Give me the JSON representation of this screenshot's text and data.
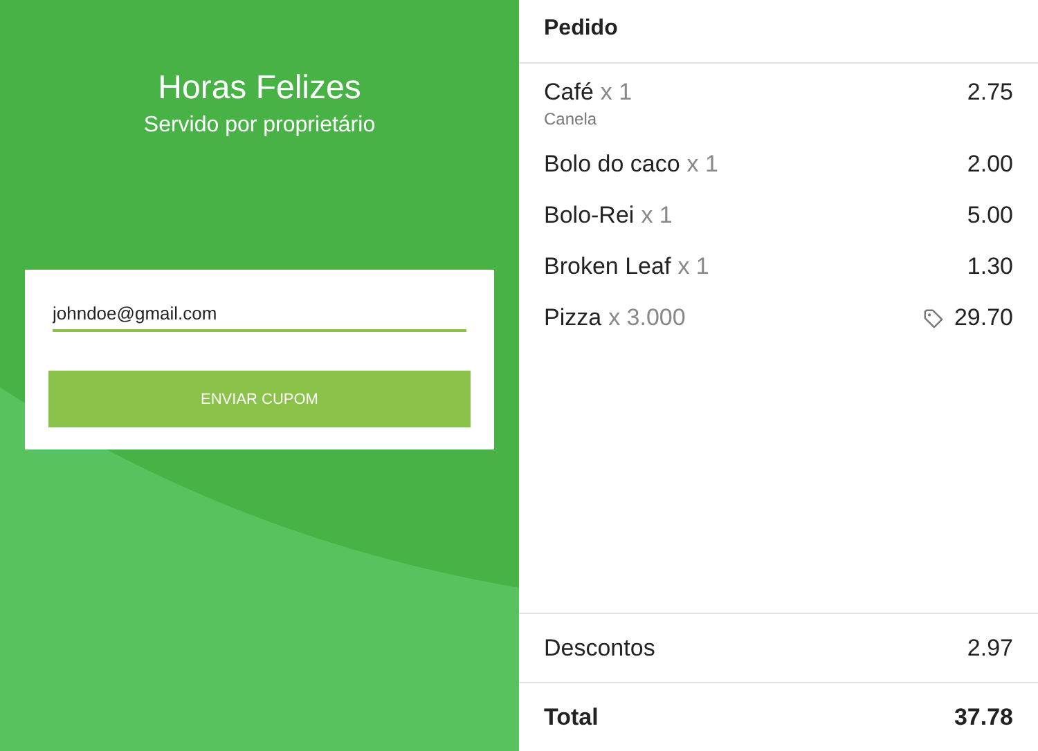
{
  "promo": {
    "title": "Horas Felizes",
    "subtitle": "Servido por proprietário"
  },
  "coupon": {
    "email": "johndoe@gmail.com",
    "button": "ENVIAR CUPOM"
  },
  "order": {
    "title": "Pedido",
    "items": [
      {
        "name": "Café",
        "quantity": "x 1",
        "note": "Canela",
        "price": "2.75",
        "discounted": false
      },
      {
        "name": "Bolo do caco",
        "quantity": "x 1",
        "price": "2.00",
        "discounted": false
      },
      {
        "name": "Bolo-Rei",
        "quantity": "x 1",
        "price": "5.00",
        "discounted": false
      },
      {
        "name": "Broken Leaf",
        "quantity": "x 1",
        "price": "1.30",
        "discounted": false
      },
      {
        "name": "Pizza",
        "quantity": "x 3.000",
        "price": "29.70",
        "discounted": true
      }
    ],
    "discounts": {
      "label": "Descontos",
      "value": "2.97"
    },
    "total": {
      "label": "Total",
      "value": "37.78"
    }
  }
}
